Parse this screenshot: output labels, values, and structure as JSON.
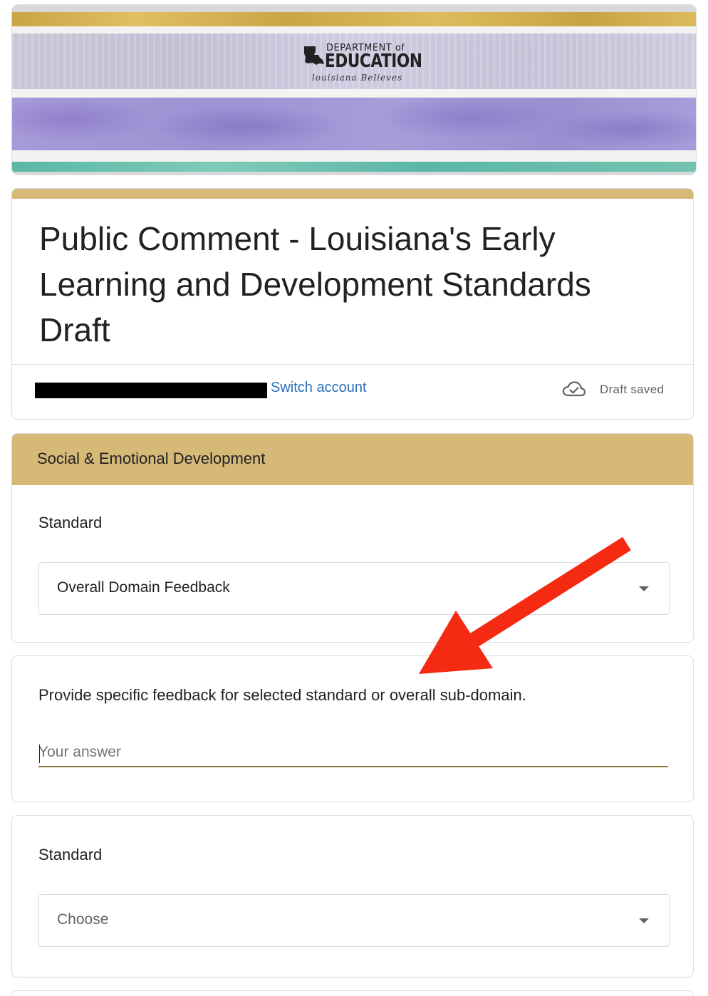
{
  "header": {
    "logo": {
      "dept_text": "DEPARTMENT of",
      "edu_text": "EDUCATION",
      "tagline": "louisiana Believes"
    },
    "colors": {
      "gold": "#d7b977",
      "purple": "#a79ad8",
      "teal": "#5cb6a6"
    }
  },
  "form": {
    "title": "Public Comment - Louisiana's Early Learning and Development Standards Draft",
    "account": {
      "email_redacted": true,
      "switch_label": "Switch account"
    },
    "status": {
      "icon": "cloud-check-icon",
      "text": "Draft saved"
    }
  },
  "section": {
    "title": "Social & Emotional Development",
    "question1": {
      "label": "Standard",
      "selected_value": "Overall Domain Feedback"
    }
  },
  "feedback": {
    "label": "Provide specific feedback for selected standard or overall sub-domain.",
    "placeholder": "Your answer"
  },
  "question2": {
    "label": "Standard",
    "placeholder": "Choose"
  },
  "annotation": {
    "type": "red-arrow",
    "color": "#f52a13"
  }
}
